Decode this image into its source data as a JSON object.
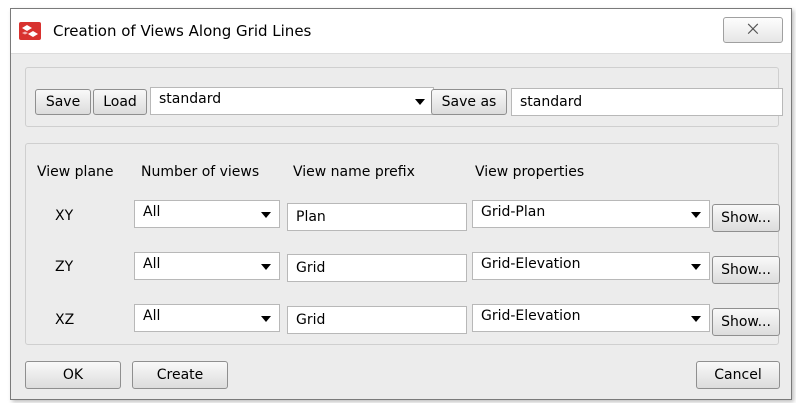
{
  "window": {
    "title": "Creation of Views Along Grid Lines",
    "close_label": "⨉"
  },
  "settings": {
    "save_label": "Save",
    "load_label": "Load",
    "preset_value": "standard",
    "save_as_label": "Save as",
    "save_as_value": "standard"
  },
  "table": {
    "headers": {
      "view_plane": "View plane",
      "number_of_views": "Number of views",
      "name_prefix": "View name prefix",
      "properties": "View properties"
    },
    "rows": [
      {
        "plane": "XY",
        "count": "All",
        "prefix": "Plan",
        "properties": "Grid-Plan",
        "show_label": "Show..."
      },
      {
        "plane": "ZY",
        "count": "All",
        "prefix": "Grid",
        "properties": "Grid-Elevation",
        "show_label": "Show..."
      },
      {
        "plane": "XZ",
        "count": "All",
        "prefix": "Grid",
        "properties": "Grid-Elevation",
        "show_label": "Show..."
      }
    ]
  },
  "footer": {
    "ok_label": "OK",
    "create_label": "Create",
    "cancel_label": "Cancel"
  },
  "colors": {
    "dialog_bg": "#ececec",
    "title_bg": "#ffffff",
    "icon_red": "#d8322f"
  },
  "icons": {
    "app": "app-logo-icon",
    "close": "close-icon",
    "dropdown": "chevron-down-icon"
  }
}
